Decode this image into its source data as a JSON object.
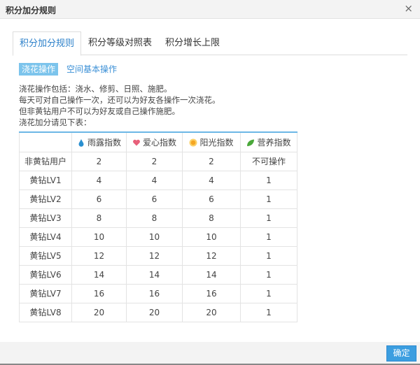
{
  "dialog": {
    "title": "积分加分规则",
    "close": "×"
  },
  "tabs": [
    {
      "label": "积分加分规则",
      "active": true
    },
    {
      "label": "积分等级对照表"
    },
    {
      "label": "积分增长上限"
    }
  ],
  "subtabs": [
    {
      "label": "浇花操作",
      "active": true
    },
    {
      "label": "空间基本操作"
    }
  ],
  "description": [
    "浇花操作包括：浇水、修剪、日照、施肥。",
    "每天可对自己操作一次，还可以为好友各操作一次浇花。",
    "但非黄钻用户不可以为好友或自己操作施肥。",
    "浇花加分请见下表："
  ],
  "table": {
    "headers": [
      {
        "label": "雨露指数",
        "icon": "water-drop-icon",
        "color": "#2a8fd0"
      },
      {
        "label": "爱心指数",
        "icon": "heart-icon",
        "color": "#e8607a"
      },
      {
        "label": "阳光指数",
        "icon": "sun-icon",
        "color": "#f5a623"
      },
      {
        "label": "营养指数",
        "icon": "leaf-icon",
        "color": "#4aa83a"
      }
    ],
    "rows": [
      [
        "非黄钻用户",
        "2",
        "2",
        "2",
        "不可操作"
      ],
      [
        "黄钻LV1",
        "4",
        "4",
        "4",
        "1"
      ],
      [
        "黄钻LV2",
        "6",
        "6",
        "6",
        "1"
      ],
      [
        "黄钻LV3",
        "8",
        "8",
        "8",
        "1"
      ],
      [
        "黄钻LV4",
        "10",
        "10",
        "10",
        "1"
      ],
      [
        "黄钻LV5",
        "12",
        "12",
        "12",
        "1"
      ],
      [
        "黄钻LV6",
        "14",
        "14",
        "14",
        "1"
      ],
      [
        "黄钻LV7",
        "16",
        "16",
        "16",
        "1"
      ],
      [
        "黄钻LV8",
        "20",
        "20",
        "20",
        "1"
      ]
    ]
  },
  "footer": {
    "confirm": "确定"
  }
}
